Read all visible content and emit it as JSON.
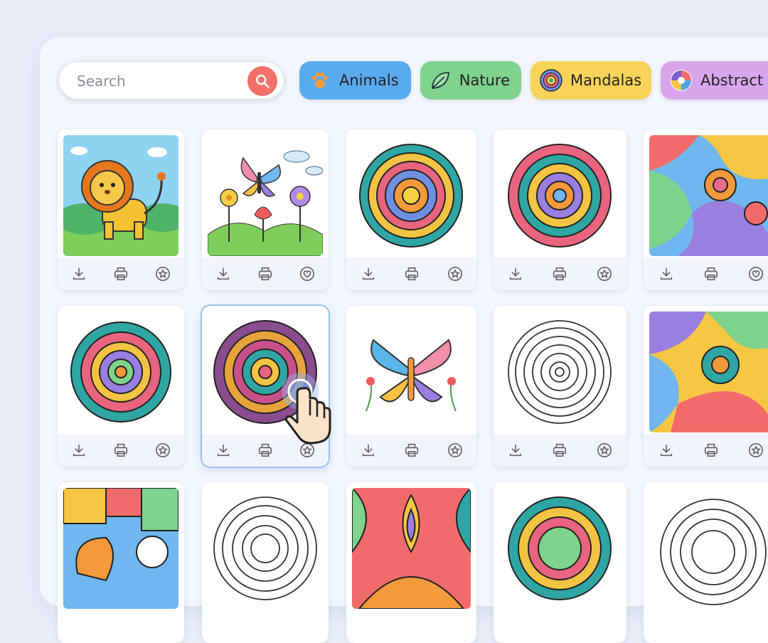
{
  "search": {
    "placeholder": "Search"
  },
  "categories": [
    {
      "label": "Animals",
      "color": "#5aaaf0",
      "icon": "paw-icon"
    },
    {
      "label": "Nature",
      "color": "#7fd38c",
      "icon": "leaf-icon"
    },
    {
      "label": "Mandalas",
      "color": "#f8d35a",
      "icon": "mandala-icon"
    },
    {
      "label": "Abstract",
      "color": "#d9a6ee",
      "icon": "swirl-icon"
    }
  ],
  "gallery": {
    "rows": [
      [
        "lion",
        "butterfly-flowers",
        "mandala-color",
        "mandala-color",
        "swirls-abstract"
      ],
      [
        "mandala-color",
        "mandala-purple",
        "butterfly",
        "mandala-outline",
        "swirls-abstract"
      ],
      [
        "mosaic-abstract",
        "mandala-outline",
        "ornament-abstract",
        "mandala-color",
        "mandala-outline"
      ]
    ],
    "selected_card": "row 2, column 2"
  },
  "card_actions": [
    "download-icon",
    "print-icon",
    "favorite-icon"
  ]
}
